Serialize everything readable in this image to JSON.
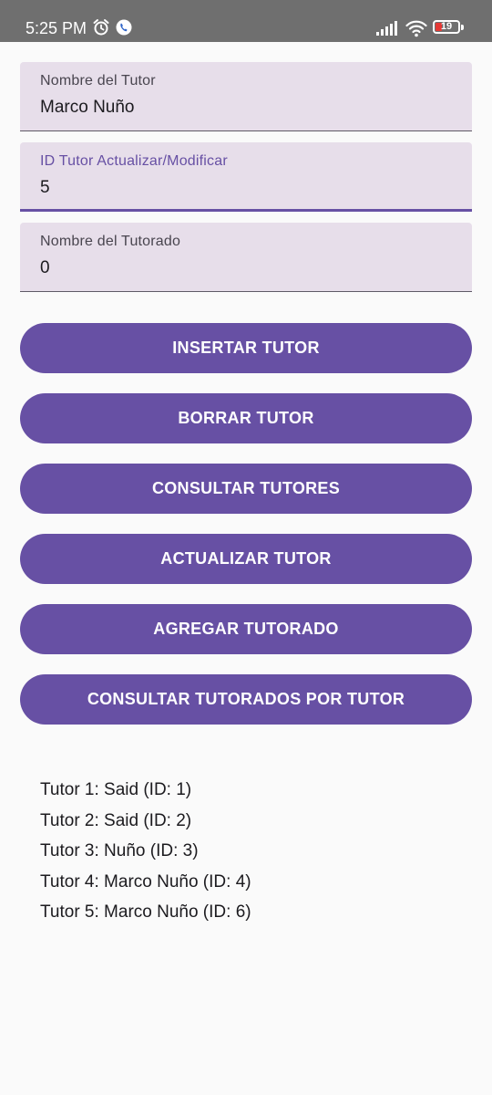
{
  "status_bar": {
    "time": "5:25 PM",
    "icons": [
      "alarm-icon",
      "phone-icon",
      "signal-icon",
      "wifi-icon",
      "battery-icon"
    ],
    "battery_level": "19",
    "battery_color": "#e53935"
  },
  "form": {
    "tutor_name": {
      "label": "Nombre del Tutor",
      "value": "Marco Nuño"
    },
    "tutor_id": {
      "label": "ID Tutor Actualizar/Modificar",
      "value": "5",
      "focused": true
    },
    "tutorado_name": {
      "label": "Nombre del Tutorado",
      "value": "0"
    }
  },
  "buttons": {
    "insertar": "INSERTAR TUTOR",
    "borrar": "BORRAR TUTOR",
    "consultar": "CONSULTAR TUTORES",
    "actualizar": "ACTUALIZAR TUTOR",
    "agregar_tutorado": "AGREGAR TUTORADO",
    "consultar_tutorados": "CONSULTAR TUTORADOS POR TUTOR"
  },
  "results": [
    "Tutor 1: Said (ID: 1)",
    "Tutor 2: Said (ID: 2)",
    "Tutor 3: Nuño (ID: 3)",
    "Tutor 4: Marco Nuño (ID: 4)",
    "Tutor 5: Marco Nuño (ID: 6)"
  ],
  "colors": {
    "primary": "#6750a4",
    "field_background": "#e7deea",
    "status_bar": "#6f6f6f"
  }
}
